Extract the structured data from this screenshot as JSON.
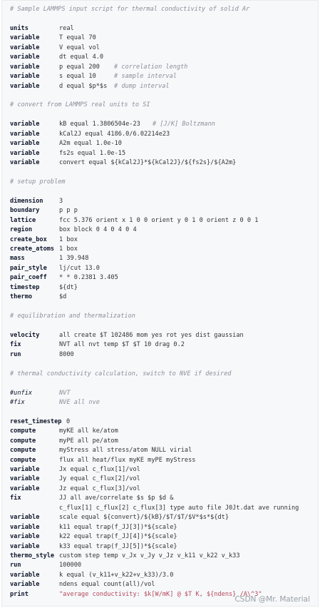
{
  "code": {
    "lines": [
      {
        "type": "comment",
        "text": "# Sample LAMMPS input script for thermal conductivity of solid Ar"
      },
      {
        "type": "blank"
      },
      {
        "type": "code",
        "kw": "units",
        "rest": "real"
      },
      {
        "type": "code",
        "kw": "variable",
        "rest": "T equal 70"
      },
      {
        "type": "code",
        "kw": "variable",
        "rest": "V equal vol"
      },
      {
        "type": "code",
        "kw": "variable",
        "rest": "dt equal 4.0"
      },
      {
        "type": "code",
        "kw": "variable",
        "rest": "p equal 200",
        "comment": "# correlation length",
        "commentCol": 146
      },
      {
        "type": "code",
        "kw": "variable",
        "rest": "s equal 10",
        "comment": "# sample interval",
        "commentCol": 146
      },
      {
        "type": "code",
        "kw": "variable",
        "rest": "d equal $p*$s",
        "comment": "# dump interval",
        "commentCol": 146
      },
      {
        "type": "blank"
      },
      {
        "type": "comment",
        "text": "# convert from LAMMPS real units to SI"
      },
      {
        "type": "blank"
      },
      {
        "type": "code",
        "kw": "variable",
        "rest": "kB equal 1.3806504e-23",
        "comment": "# [J/K] Boltzmann",
        "commentCol": 200
      },
      {
        "type": "code",
        "kw": "variable",
        "rest": "kCal2J equal 4186.0/6.02214e23"
      },
      {
        "type": "code",
        "kw": "variable",
        "rest": "A2m equal 1.0e-10"
      },
      {
        "type": "code",
        "kw": "variable",
        "rest": "fs2s equal 1.0e-15"
      },
      {
        "type": "code",
        "kw": "variable",
        "rest": "convert equal ${kCal2J}*${kCal2J}/${fs2s}/${A2m}"
      },
      {
        "type": "blank"
      },
      {
        "type": "comment",
        "text": "# setup problem"
      },
      {
        "type": "blank"
      },
      {
        "type": "code",
        "kw": "dimension",
        "rest": "3"
      },
      {
        "type": "code",
        "kw": "boundary",
        "rest": "p p p"
      },
      {
        "type": "code",
        "kw": "lattice",
        "rest": "fcc 5.376 orient x 1 0 0 orient y 0 1 0 orient z 0 0 1"
      },
      {
        "type": "code",
        "kw": "region",
        "rest": "box block 0 4 0 4 0 4"
      },
      {
        "type": "code",
        "kw": "create_box",
        "rest": "1 box"
      },
      {
        "type": "code",
        "kw": "create_atoms",
        "rest": "1 box"
      },
      {
        "type": "code",
        "kw": "mass",
        "rest": "1 39.948"
      },
      {
        "type": "code",
        "kw": "pair_style",
        "rest": "lj/cut 13.0"
      },
      {
        "type": "code",
        "kw": "pair_coeff",
        "rest": "* * 0.2381 3.405"
      },
      {
        "type": "code",
        "kw": "timestep",
        "rest": "${dt}"
      },
      {
        "type": "code",
        "kw": "thermo",
        "rest": "$d"
      },
      {
        "type": "blank"
      },
      {
        "type": "comment",
        "text": "# equilibration and thermalization"
      },
      {
        "type": "blank"
      },
      {
        "type": "code",
        "kw": "velocity",
        "rest": "all create $T 102486 mom yes rot yes dist gaussian"
      },
      {
        "type": "code",
        "kw": "fix",
        "rest": "NVT all nvt temp $T $T 10 drag 0.2"
      },
      {
        "type": "code",
        "kw": "run",
        "rest": "8000"
      },
      {
        "type": "blank"
      },
      {
        "type": "comment",
        "text": "# thermal conductivity calculation, switch to NVE if desired"
      },
      {
        "type": "blank"
      },
      {
        "type": "commentkw",
        "kw": "#unfix",
        "rest": "NVT"
      },
      {
        "type": "commentkw",
        "kw": "#fix",
        "rest": "NVE all nve"
      },
      {
        "type": "blank"
      },
      {
        "type": "code",
        "kw": "reset_timestep",
        "rest": "0",
        "restCol": 79
      },
      {
        "type": "code",
        "kw": "compute",
        "rest": "myKE all ke/atom"
      },
      {
        "type": "code",
        "kw": "compute",
        "rest": "myPE all pe/atom"
      },
      {
        "type": "code",
        "kw": "compute",
        "rest": "myStress all stress/atom NULL virial"
      },
      {
        "type": "code",
        "kw": "compute",
        "rest": "flux all heat/flux myKE myPE myStress"
      },
      {
        "type": "code",
        "kw": "variable",
        "rest": "Jx equal c_flux[1]/vol"
      },
      {
        "type": "code",
        "kw": "variable",
        "rest": "Jy equal c_flux[2]/vol"
      },
      {
        "type": "code",
        "kw": "variable",
        "rest": "Jz equal c_flux[3]/vol"
      },
      {
        "type": "code",
        "kw": "fix",
        "rest": "JJ all ave/correlate $s $p $d &"
      },
      {
        "type": "code",
        "kw": "",
        "rest": "c_flux[1] c_flux[2] c_flux[3] type auto file J0Jt.dat ave running"
      },
      {
        "type": "code",
        "kw": "variable",
        "rest": "scale equal ${convert}/${kB}/$T/$T/$V*$s*${dt}"
      },
      {
        "type": "code",
        "kw": "variable",
        "rest": "k11 equal trap(f_JJ[3])*${scale}"
      },
      {
        "type": "code",
        "kw": "variable",
        "rest": "k22 equal trap(f_JJ[4])*${scale}"
      },
      {
        "type": "code",
        "kw": "variable",
        "rest": "k33 equal trap(f_JJ[5])*${scale}"
      },
      {
        "type": "code",
        "kw": "thermo_style",
        "rest": "custom step temp v_Jx v_Jy v_Jz v_k11 v_k22 v_k33"
      },
      {
        "type": "code",
        "kw": "run",
        "rest": "100000"
      },
      {
        "type": "code",
        "kw": "variable",
        "rest": "k equal (v_k11+v_k22+v_k33)/3.0"
      },
      {
        "type": "code",
        "kw": "variable",
        "rest": "ndens equal count(all)/vol"
      },
      {
        "type": "code",
        "kw": "print",
        "rest": "\"average conductivity: $k[W/mK] @ $T K, ${ndens} /A\\^3\"",
        "isString": true
      }
    ]
  },
  "watermark": "CSDN @Mr. Material"
}
